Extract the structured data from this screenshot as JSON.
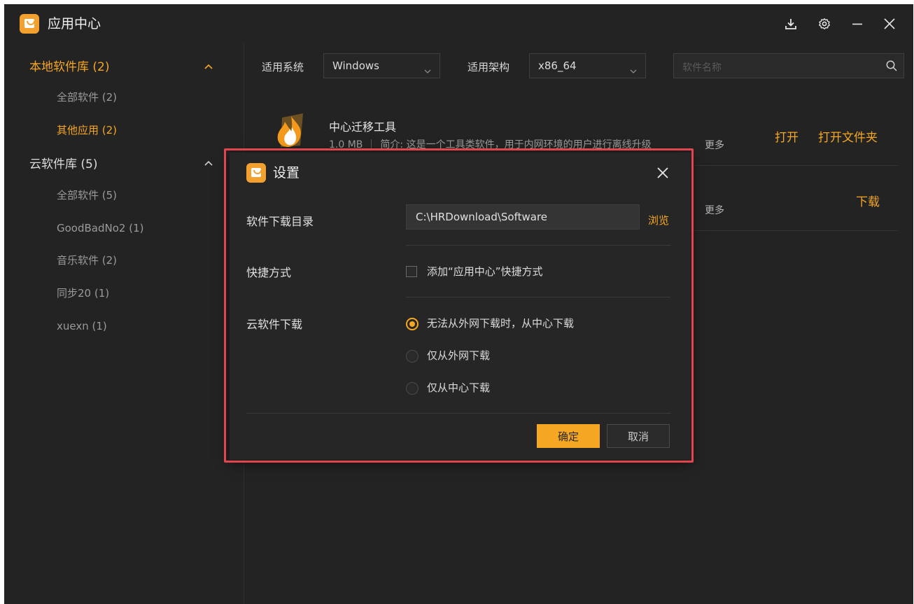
{
  "app": {
    "title": "应用中心",
    "titlebar_icons": [
      "download-icon",
      "gear-icon",
      "minimize-icon",
      "close-icon"
    ]
  },
  "sidebar": {
    "groups": [
      {
        "label": "本地软件库 (2)",
        "expanded": true,
        "items": [
          {
            "label": "全部软件 (2)",
            "selected": false
          },
          {
            "label": "其他应用 (2)",
            "selected": true
          }
        ]
      },
      {
        "label": "云软件库 (5)",
        "expanded": true,
        "items": [
          {
            "label": "全部软件 (5)",
            "selected": false
          },
          {
            "label": "GoodBadNo2 (1)",
            "selected": false
          },
          {
            "label": "音乐软件 (2)",
            "selected": false
          },
          {
            "label": "同步20 (1)",
            "selected": false
          },
          {
            "label": "xuexn (1)",
            "selected": false
          }
        ]
      }
    ]
  },
  "filters": {
    "os_label": "适用系统",
    "os_value": "Windows",
    "arch_label": "适用架构",
    "arch_value": "x86_64",
    "search_placeholder": "软件名称"
  },
  "apps": [
    {
      "name": "中心迁移工具",
      "size": "1.0 MB",
      "desc": "简介: 这是一个工具类软件，用于内网环境的用户进行离线升级",
      "more": "更多",
      "actions": [
        "打开",
        "打开文件夹"
      ]
    },
    {
      "more": "更多",
      "actions": [
        "下载"
      ]
    }
  ],
  "settings_dialog": {
    "title": "设置",
    "download_dir_label": "软件下载目录",
    "download_dir_value": "C:\\HRDownload\\Software",
    "browse": "浏览",
    "shortcut_label": "快捷方式",
    "shortcut_checkbox": "添加“应用中心”快捷方式",
    "shortcut_checked": false,
    "cloud_download_label": "云软件下载",
    "cloud_download_options": [
      {
        "label": "无法从外网下载时，从中心下载",
        "selected": true
      },
      {
        "label": "仅从外网下载",
        "selected": false
      },
      {
        "label": "仅从中心下载",
        "selected": false
      }
    ],
    "ok": "确定",
    "cancel": "取消"
  },
  "colors": {
    "background": "#232323",
    "accent": "#f5a623",
    "highlight_border": "#e3454f"
  }
}
